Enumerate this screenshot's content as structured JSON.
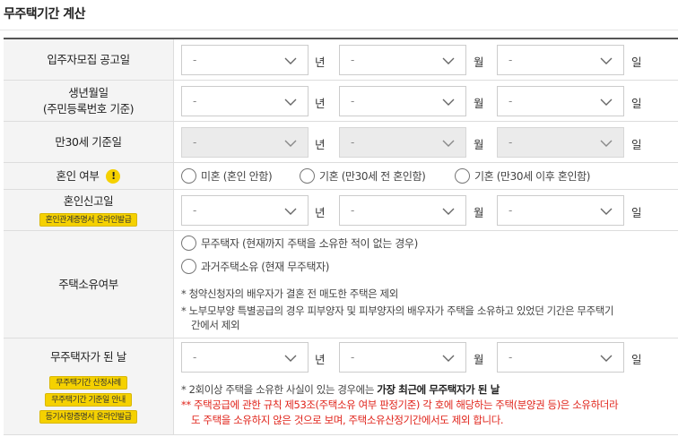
{
  "page_title": "무주택기간 계산",
  "date_units": {
    "year": "년",
    "month": "월",
    "day": "일"
  },
  "select_placeholder": "-",
  "rows": {
    "notice_date": {
      "label": "입주자모집 공고일"
    },
    "birth_date": {
      "label": "생년월일",
      "sublabel": "(주민등록번호 기준)"
    },
    "age30_date": {
      "label": "만30세 기준일"
    },
    "marital": {
      "label": "혼인 여부",
      "warn_icon": "!",
      "options": [
        "미혼 (혼인 안함)",
        "기혼 (만30세 전 혼인함)",
        "기혼 (만30세 이후 혼인함)"
      ]
    },
    "marriage_date": {
      "label": "혼인신고일",
      "button": "혼인관계증명서 온라인발급"
    },
    "home_ownership": {
      "label": "주택소유여부",
      "options": [
        "무주택자 (현재까지 주택을 소유한 적이 없는 경우)",
        "과거주택소유 (현재 무주택자)"
      ],
      "notes": [
        "* 청약신청자의 배우자가 결혼 전 매도한 주택은 제외",
        "* 노부모부양 특별공급의 경우 피부양자 및 피부양자의 배우자가 주택을 소유하고 있었던 기간은 무주택기",
        "간에서 제외"
      ]
    },
    "homeless_date": {
      "label": "무주택자가 된 날",
      "buttons": [
        "무주택기간 산정사례",
        "무주택기간 기준일 안내",
        "등기사항증명서 온라인발급"
      ],
      "note1_prefix": "* 2회이상 주택을 소유한 사실이 있는 경우에는 ",
      "note1_bold": "가장 최근에 무주택자가 된 날",
      "note2": "** 주택공급에 관한 규칙 제53조(주택소유 여부 판정기준) 각 호에 해당하는 주택(분양권 등)은 소유하더라",
      "note3": "도 주택을 소유하지 않은 것으로 보며, 주택소유산정기간에서도 제외 합니다."
    }
  },
  "colors": {
    "accent_yellow": "#f5d100",
    "warning_red": "#e0241b",
    "label_bg": "#f4f4f4",
    "disabled_bg": "#ebebeb"
  }
}
